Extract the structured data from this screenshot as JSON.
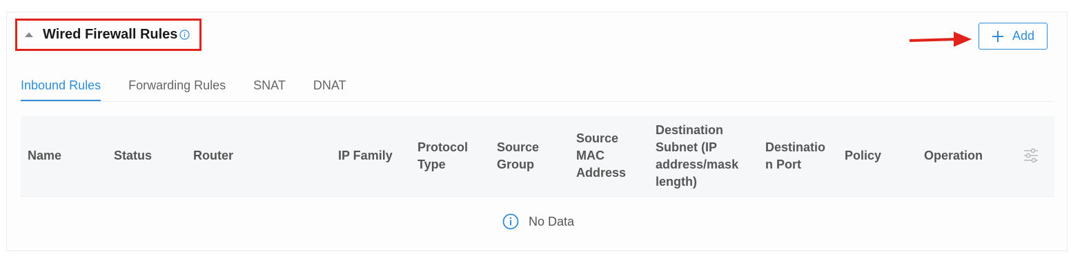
{
  "section": {
    "title": "Wired Firewall Rules",
    "title_info_icon": "info-circle-icon",
    "collapse_icon": "caret-up-icon"
  },
  "toolbar": {
    "add_label": "Add",
    "add_icon": "plus-icon"
  },
  "annotations": {
    "highlight_color": "#e0221b",
    "arrow_color": "#e0221b"
  },
  "tabs": [
    {
      "label": "Inbound Rules",
      "active": true
    },
    {
      "label": "Forwarding Rules",
      "active": false
    },
    {
      "label": "SNAT",
      "active": false
    },
    {
      "label": "DNAT",
      "active": false
    }
  ],
  "table": {
    "columns": [
      "Name",
      "Status",
      "Router",
      "IP Family",
      "Protocol Type",
      "Source Group",
      "Source MAC Address",
      "Destination Subnet (IP address/mask length)",
      "Destination Port",
      "Policy",
      "Operation"
    ],
    "column_settings_icon": "sliders-icon",
    "empty_text": "No Data",
    "empty_icon": "info-circle-icon"
  },
  "colors": {
    "accent": "#2d8ddb",
    "header_bg": "#f6f7f8"
  }
}
